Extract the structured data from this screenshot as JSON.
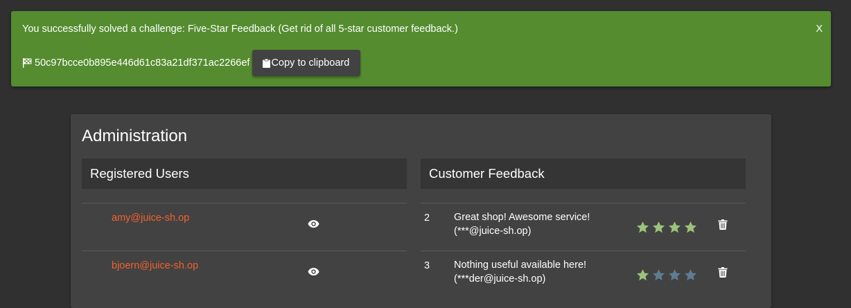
{
  "banner": {
    "message": "You successfully solved a challenge: Five-Star Feedback (Get rid of all 5-star customer feedback.)",
    "close_label": "X",
    "flag_code": "50c97bcce0b895e446d61c83a21df371ac2266ef",
    "copy_label": "Copy to clipboard",
    "color": "#548c2f"
  },
  "admin": {
    "title": "Administration",
    "users": {
      "header": "Registered Users",
      "rows": [
        {
          "email": "amy@juice-sh.op",
          "icon": "eye-icon"
        },
        {
          "email": "bjoern@juice-sh.op",
          "icon": "eye-icon"
        }
      ]
    },
    "feedback": {
      "header": "Customer Feedback",
      "rows": [
        {
          "id": "2",
          "comment_line1": "Great shop! Awesome service!",
          "comment_line2": "(***@juice-sh.op)",
          "rating": 4,
          "max_rating": 4
        },
        {
          "id": "3",
          "comment_line1": "Nothing useful available here!",
          "comment_line2": "(***der@juice-sh.op)",
          "rating": 1,
          "max_rating": 4
        }
      ]
    }
  },
  "colors": {
    "accent_link": "#f3612e",
    "star_filled": "#9bc47a",
    "star_empty": "#5e7d94",
    "background": "#303030",
    "card": "#424242"
  }
}
